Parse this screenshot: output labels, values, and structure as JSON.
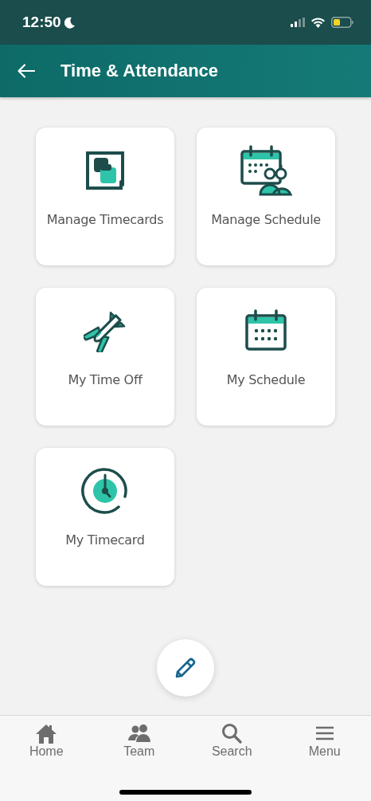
{
  "status_bar": {
    "time": "12:50"
  },
  "header": {
    "title": "Time & Attendance"
  },
  "tiles": [
    {
      "label": "Manage Timecards",
      "kind": "timecards"
    },
    {
      "label": "Manage Schedule",
      "kind": "team-schedule"
    },
    {
      "label": "My Time Off",
      "kind": "time-off"
    },
    {
      "label": "My Schedule",
      "kind": "schedule"
    },
    {
      "label": "My Timecard",
      "kind": "timecard"
    }
  ],
  "tab_bar": [
    {
      "label": "Home",
      "kind": "home"
    },
    {
      "label": "Team",
      "kind": "team"
    },
    {
      "label": "Search",
      "kind": "search"
    },
    {
      "label": "Menu",
      "kind": "menu"
    }
  ]
}
